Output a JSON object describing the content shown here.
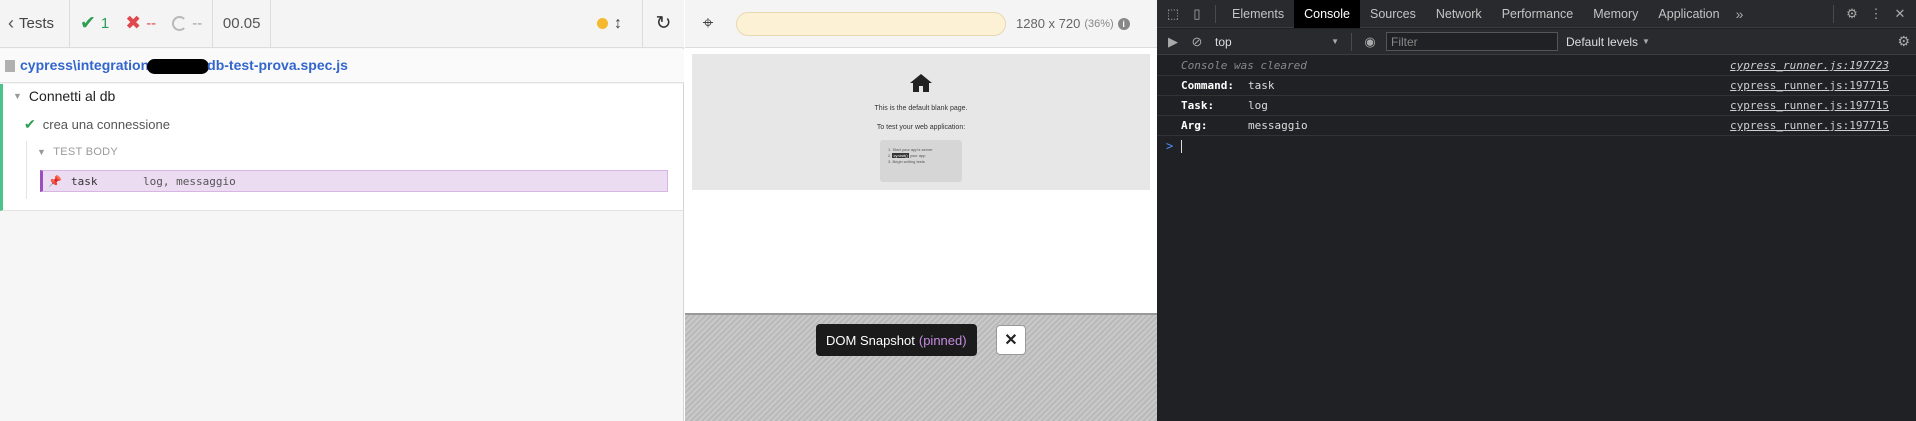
{
  "reporter": {
    "tests_label": "Tests",
    "stats": {
      "passed": "1",
      "failed": "--",
      "pending": "--"
    },
    "duration": "00.05",
    "spec_path_prefix": "cypress\\integration",
    "spec_path_suffix": "db-test-prova.spec.js",
    "suite_title": "Connetti al db",
    "test_title": "crea una connessione",
    "body_label": "TEST BODY",
    "command": {
      "name": "task",
      "message": "log, messaggio"
    },
    "status_dot_color": "#f5b82e"
  },
  "aut": {
    "viewport_size": "1280 x 720",
    "viewport_scale": "(36%)",
    "blank_title": "This is the default blank page.",
    "blank_sub": "To test your web application:",
    "blank_steps": [
      "1. Start your app's server",
      "your app",
      "3. Begin writing tests"
    ],
    "blank_step2_highlight": "cy.visit()",
    "blank_step2_prefix": "2. ",
    "snapshot_label": "DOM Snapshot",
    "snapshot_pinned": "(pinned)"
  },
  "devtools": {
    "tabs": [
      "Elements",
      "Console",
      "Sources",
      "Network",
      "Performance",
      "Memory",
      "Application"
    ],
    "active_tab": "Console",
    "context": "top",
    "filter_placeholder": "Filter",
    "levels": "Default levels",
    "console": {
      "cleared": "Console was cleared",
      "cleared_src": "cypress_runner.js:197723",
      "rows": [
        {
          "key": "Command:",
          "value": "task",
          "src": "cypress_runner.js:197715"
        },
        {
          "key": "Task:",
          "value": "log",
          "src": "cypress_runner.js:197715"
        },
        {
          "key": "Arg:",
          "value": "messaggio",
          "src": "cypress_runner.js:197715"
        }
      ],
      "prompt": ">"
    }
  }
}
